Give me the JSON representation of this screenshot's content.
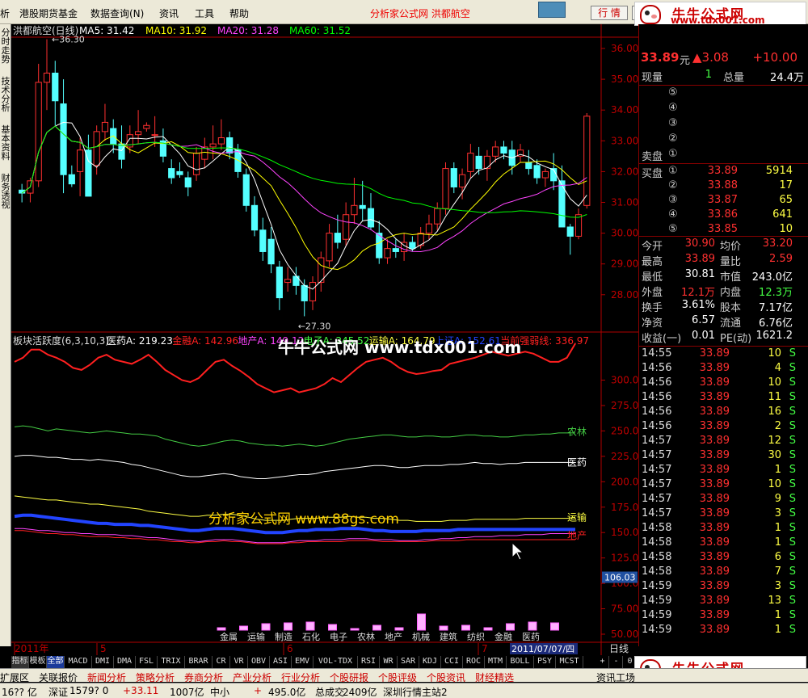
{
  "menu": {
    "items": [
      "析",
      "港股期货基金",
      "数据查询(N)",
      "资讯",
      "工具",
      "帮助"
    ],
    "site_title": "分析家公式网 洪都航空",
    "btn_quote": "行 情",
    "btn_info": "资 讯"
  },
  "logo": {
    "line1": "牛牛公式网",
    "line2": "www.tdx001.com"
  },
  "lefttabs": [
    "分时走势",
    "技术分析",
    "基本资料",
    "财务透视"
  ],
  "kline": {
    "title": "洪都航空(日线)",
    "mas": [
      {
        "label": "MA5: 31.42",
        "color": "#ffffff"
      },
      {
        "label": "MA10: 31.92",
        "color": "#ffff00"
      },
      {
        "label": "MA20: 31.28",
        "color": "#ff44ff"
      },
      {
        "label": "MA60: 31.52",
        "color": "#00ff00"
      }
    ],
    "yticks": [
      "36.00",
      "35.00",
      "34.00",
      "33.00",
      "32.00",
      "31.00",
      "30.00",
      "29.00",
      "28.00"
    ],
    "high_mark": "36.30",
    "low_mark": "27.30",
    "candles": [
      [
        31.4,
        31.6,
        31.0,
        31.3
      ],
      [
        31.3,
        31.8,
        31.0,
        31.7
      ],
      [
        31.7,
        35.5,
        31.5,
        34.9
      ],
      [
        34.9,
        36.3,
        34.0,
        35.2
      ],
      [
        35.2,
        35.6,
        33.5,
        34.3
      ],
      [
        34.2,
        35.0,
        31.3,
        31.9
      ],
      [
        31.9,
        32.2,
        31.5,
        31.6
      ],
      [
        32.0,
        33.1,
        31.2,
        32.7
      ],
      [
        32.7,
        33.2,
        31.3,
        31.2
      ],
      [
        32.2,
        33.5,
        31.9,
        33.3
      ],
      [
        33.3,
        34.2,
        33.0,
        33.6
      ],
      [
        33.4,
        33.7,
        32.6,
        32.9
      ],
      [
        32.9,
        33.5,
        32.1,
        32.4
      ],
      [
        32.8,
        33.5,
        32.6,
        33.2
      ],
      [
        33.2,
        34.0,
        32.9,
        33.3
      ],
      [
        33.4,
        33.6,
        33.3,
        33.5
      ],
      [
        33.2,
        33.8,
        32.8,
        33.2
      ],
      [
        33.0,
        33.4,
        32.3,
        32.5
      ],
      [
        32.1,
        32.4,
        31.6,
        31.8
      ],
      [
        32.0,
        32.3,
        31.8,
        31.9
      ],
      [
        31.8,
        32.0,
        31.2,
        31.5
      ],
      [
        31.9,
        32.8,
        31.7,
        32.6
      ],
      [
        32.4,
        33.1,
        32.1,
        32.8
      ],
      [
        32.8,
        33.5,
        32.4,
        32.9
      ],
      [
        32.9,
        33.7,
        32.7,
        33.1
      ],
      [
        33.1,
        33.3,
        32.4,
        32.6
      ],
      [
        32.7,
        32.9,
        31.8,
        32.0
      ],
      [
        31.9,
        32.1,
        30.7,
        30.9
      ],
      [
        30.9,
        31.2,
        29.9,
        30.1
      ],
      [
        30.1,
        30.5,
        29.1,
        29.4
      ],
      [
        29.8,
        30.2,
        28.7,
        29.0
      ],
      [
        28.9,
        29.1,
        27.5,
        27.9
      ],
      [
        28.4,
        28.9,
        28.1,
        28.5
      ],
      [
        28.6,
        28.9,
        28.0,
        28.3
      ],
      [
        28.3,
        28.5,
        27.3,
        27.8
      ],
      [
        27.8,
        28.6,
        27.5,
        28.4
      ],
      [
        28.4,
        29.4,
        28.1,
        29.2
      ],
      [
        29.1,
        30.3,
        28.9,
        30.0
      ],
      [
        30.0,
        30.6,
        29.5,
        29.7
      ],
      [
        29.8,
        31.0,
        29.6,
        30.6
      ],
      [
        30.6,
        31.8,
        30.3,
        30.9
      ],
      [
        30.9,
        31.7,
        30.4,
        30.8
      ],
      [
        30.8,
        31.3,
        30.1,
        30.2
      ],
      [
        30.0,
        30.4,
        29.0,
        29.2
      ],
      [
        29.2,
        29.8,
        29.0,
        29.5
      ],
      [
        29.5,
        29.8,
        29.2,
        29.4
      ],
      [
        29.4,
        30.0,
        29.1,
        29.7
      ],
      [
        29.7,
        29.9,
        29.4,
        29.5
      ],
      [
        29.6,
        30.2,
        29.5,
        30.0
      ],
      [
        30.0,
        30.6,
        29.8,
        30.3
      ],
      [
        30.3,
        31.0,
        30.1,
        30.8
      ],
      [
        30.8,
        32.3,
        30.6,
        32.1
      ],
      [
        32.1,
        32.3,
        31.3,
        31.5
      ],
      [
        31.5,
        32.1,
        31.1,
        31.9
      ],
      [
        32.0,
        32.9,
        31.8,
        32.6
      ],
      [
        32.5,
        32.8,
        31.9,
        32.1
      ],
      [
        32.1,
        32.7,
        31.7,
        32.5
      ],
      [
        32.5,
        33.0,
        32.3,
        32.8
      ],
      [
        32.8,
        33.0,
        32.4,
        32.6
      ],
      [
        32.7,
        33.0,
        31.9,
        32.2
      ],
      [
        32.5,
        32.9,
        32.3,
        32.7
      ],
      [
        32.3,
        32.7,
        31.9,
        32.1
      ],
      [
        32.2,
        32.4,
        31.6,
        31.8
      ],
      [
        31.8,
        32.1,
        31.5,
        32.0
      ],
      [
        32.1,
        32.6,
        31.4,
        31.7
      ],
      [
        31.7,
        32.2,
        30.6,
        30.2
      ],
      [
        30.2,
        30.3,
        29.3,
        29.9
      ],
      [
        29.9,
        30.8,
        29.8,
        30.6
      ],
      [
        30.9,
        33.9,
        30.8,
        33.8
      ]
    ]
  },
  "indicator": {
    "title": "板块活跃度(6,3,10,3)",
    "legend": [
      {
        "text": "医药A: 219.23",
        "color": "#ffffff"
      },
      {
        "text": "金融A: 142.96",
        "color": "#ff2020"
      },
      {
        "text": "地产A: 149.12",
        "color": "#ff44ff"
      },
      {
        "text": "电子A: 245.52",
        "color": "#44ff44"
      },
      {
        "text": "运输A: 164.79",
        "color": "#ffff44"
      },
      {
        "text": "上证A: 152.61",
        "color": "#2244ff"
      },
      {
        "text": "当前强弱线: 336.97",
        "color": "#ff2020"
      }
    ],
    "yticks": [
      "300.00",
      "275.00",
      "250.00",
      "225.00",
      "200.00",
      "175.00",
      "150.00",
      "125.00",
      "100.00",
      "75.00",
      "50.00",
      "25.00"
    ],
    "current_value": "106.03",
    "line_labels": [
      "农林",
      "医药",
      "运输",
      "地产"
    ],
    "bar_labels": [
      "金属",
      "运输",
      "制造",
      "石化",
      "电子",
      "农林",
      "地产",
      "机械",
      "建筑",
      "纺织",
      "金融",
      "医药"
    ],
    "bar_values": [
      3,
      5,
      8,
      9,
      10,
      7,
      2,
      6,
      3,
      20,
      5,
      6,
      3,
      8,
      10,
      9
    ],
    "series": {
      "top": [
        318,
        322,
        330,
        330,
        325,
        322,
        318,
        312,
        310,
        315,
        322,
        325,
        320,
        318,
        316,
        320,
        325,
        318,
        310,
        305,
        300,
        298,
        302,
        310,
        318,
        320,
        314,
        309,
        303,
        296,
        292,
        288,
        290,
        292,
        288,
        290,
        292,
        296,
        302,
        298,
        305,
        312,
        318,
        320,
        322,
        318,
        312,
        308,
        306,
        307,
        309,
        310,
        316,
        318,
        320,
        322,
        325,
        328,
        326,
        324,
        326,
        328,
        326,
        322,
        318,
        318,
        322,
        336
      ],
      "nonglin": [
        254,
        255,
        254,
        252,
        250,
        252,
        251,
        250,
        249,
        248,
        249,
        250,
        249,
        248,
        247,
        247,
        246,
        245,
        242,
        240,
        238,
        236,
        235,
        236,
        238,
        240,
        241,
        240,
        238,
        237,
        236,
        236,
        235,
        236,
        237,
        236,
        235,
        236,
        238,
        240,
        242,
        243,
        244,
        245,
        246,
        246,
        245,
        244,
        244,
        245,
        245,
        244,
        244,
        245,
        246,
        246,
        245,
        245,
        244,
        244,
        245,
        246,
        246,
        247,
        247,
        248,
        248,
        248
      ],
      "yiyao": [
        225,
        226,
        226,
        225,
        224,
        224,
        223,
        222,
        222,
        221,
        222,
        221,
        220,
        219,
        217,
        216,
        214,
        212,
        210,
        208,
        206,
        205,
        205,
        206,
        207,
        208,
        207,
        205,
        204,
        203,
        203,
        204,
        205,
        206,
        207,
        207,
        208,
        210,
        211,
        212,
        213,
        214,
        215,
        216,
        216,
        215,
        214,
        214,
        215,
        216,
        216,
        216,
        217,
        217,
        218,
        219,
        218,
        218,
        217,
        218,
        218,
        219,
        219,
        219,
        219,
        219,
        219,
        219
      ],
      "yunshu": [
        186,
        185,
        184,
        183,
        182,
        182,
        181,
        180,
        179,
        178,
        178,
        177,
        176,
        175,
        174,
        173,
        171,
        170,
        169,
        168,
        167,
        166,
        166,
        167,
        167,
        168,
        168,
        167,
        165,
        163,
        162,
        162,
        162,
        163,
        164,
        164,
        164,
        165,
        165,
        165,
        166,
        165,
        165,
        164,
        164,
        163,
        162,
        162,
        161,
        161,
        161,
        161,
        162,
        162,
        162,
        163,
        163,
        163,
        163,
        163,
        163,
        164,
        164,
        164,
        164,
        164,
        164,
        165
      ],
      "shangzheng": [
        166,
        167,
        167,
        166,
        165,
        164,
        163,
        162,
        161,
        160,
        159,
        159,
        158,
        158,
        158,
        157,
        157,
        156,
        155,
        154,
        153,
        152,
        152,
        153,
        154,
        154,
        154,
        153,
        152,
        151,
        150,
        150,
        150,
        151,
        152,
        152,
        153,
        153,
        153,
        154,
        154,
        154,
        153,
        152,
        152,
        151,
        151,
        151,
        151,
        152,
        152,
        152,
        152,
        153,
        153,
        153,
        153,
        153,
        153,
        153,
        153,
        153,
        153,
        153,
        153,
        153,
        153,
        153
      ],
      "dichan": [
        154,
        154,
        153,
        152,
        152,
        151,
        150,
        150,
        149,
        149,
        148,
        148,
        148,
        147,
        147,
        146,
        145,
        145,
        144,
        143,
        142,
        142,
        141,
        142,
        143,
        143,
        143,
        142,
        141,
        140,
        140,
        140,
        140,
        141,
        142,
        142,
        142,
        143,
        143,
        143,
        144,
        144,
        144,
        143,
        143,
        143,
        142,
        142,
        142,
        143,
        143,
        144,
        144,
        145,
        145,
        146,
        146,
        146,
        147,
        147,
        147,
        148,
        148,
        148,
        149,
        149,
        149,
        149
      ],
      "jinrong": [
        152,
        152,
        151,
        150,
        149,
        149,
        148,
        148,
        147,
        146,
        146,
        146,
        145,
        145,
        144,
        144,
        143,
        143,
        142,
        141,
        141,
        140,
        140,
        141,
        141,
        142,
        141,
        141,
        140,
        139,
        139,
        139,
        139,
        140,
        140,
        141,
        141,
        141,
        141,
        141,
        142,
        142,
        142,
        142,
        141,
        141,
        141,
        141,
        141,
        141,
        142,
        142,
        142,
        142,
        143,
        143,
        143,
        143,
        143,
        143,
        143,
        143,
        143,
        143,
        143,
        143,
        143,
        143
      ]
    }
  },
  "watermarks": {
    "w1": "牛牛公式网 www.tdx001.com",
    "w2": "分析家公式网 www.88gs.com"
  },
  "timeline": {
    "labels": [
      "2011年",
      "5",
      "6",
      "7"
    ],
    "date_box": "2011/07/07/四",
    "period": "日线"
  },
  "indicator_tabs": [
    "指标",
    "模板",
    "全部",
    "MACD",
    "DMI",
    "DMA",
    "FSL",
    "TRIX",
    "BRAR",
    "CR",
    "VR",
    "OBV",
    "ASI",
    "EMV",
    "VOL-TDX",
    "RSI",
    "WR",
    "SAR",
    "KDJ",
    "CCI",
    "ROC",
    "MTM",
    "BOLL",
    "PSY",
    "MCST"
  ],
  "scroll_controls": [
    "+",
    "-",
    "0"
  ],
  "nav": [
    "扩展区",
    "关联报价",
    "新闻分析",
    "策略分析",
    "券商分析",
    "产业分析",
    "行业分析",
    "个股研报",
    "个股评级",
    "个股资讯",
    "财经精选"
  ],
  "nav_right": "资讯工场",
  "status": [
    "16?? 亿",
    "深证",
    "1579? 0",
    "+33.11",
    "1007亿",
    "中小",
    "",
    "",
    "+",
    "495.0亿",
    "总成交",
    "2409亿",
    "深圳行情主站2"
  ],
  "quote": {
    "price": "33.89",
    "unit": "元",
    "change": "▲3.08",
    "pct": "+10.00",
    "xianliang_label": "现量",
    "xianliang": "1",
    "zongliang_label": "总量",
    "zongliang": "24.4万",
    "sell_levels": [
      "⑤",
      "④",
      "③",
      "②",
      "①"
    ],
    "sell_label": "卖盘",
    "buy_label": "买盘",
    "buy": [
      {
        "lvl": "①",
        "price": "33.89",
        "vol": "5914"
      },
      {
        "lvl": "②",
        "price": "33.88",
        "vol": "17"
      },
      {
        "lvl": "③",
        "price": "33.87",
        "vol": "65"
      },
      {
        "lvl": "④",
        "price": "33.86",
        "vol": "641"
      },
      {
        "lvl": "⑤",
        "price": "33.85",
        "vol": "10"
      }
    ],
    "stats": [
      {
        "l1": "今开",
        "v1": "30.90",
        "c1": "#ff3030",
        "l2": "均价",
        "v2": "33.20",
        "c2": "#ff3030"
      },
      {
        "l1": "最高",
        "v1": "33.89",
        "c1": "#ff3030",
        "l2": "量比",
        "v2": "2.59",
        "c2": "#ff3030"
      },
      {
        "l1": "最低",
        "v1": "30.81",
        "c1": "#ffffff",
        "l2": "市值",
        "v2": "243.0亿",
        "c2": "#ffffff"
      },
      {
        "l1": "外盘",
        "v1": "12.1万",
        "c1": "#ff3030",
        "l2": "内盘",
        "v2": "12.3万",
        "c2": "#44ff44"
      },
      {
        "l1": "换手",
        "v1": "3.61%",
        "c1": "#ffffff",
        "l2": "股本",
        "v2": "7.17亿",
        "c2": "#ffffff"
      },
      {
        "l1": "净资",
        "v1": "6.57",
        "c1": "#ffffff",
        "l2": "流通",
        "v2": "6.76亿",
        "c2": "#ffffff"
      },
      {
        "l1": "收益(一)",
        "v1": "0.01",
        "c1": "#ffffff",
        "l2": "PE(动)",
        "v2": "1621.2",
        "c2": "#ffffff"
      }
    ],
    "ticks": [
      {
        "t": "14:55",
        "p": "33.89",
        "v": "10",
        "s": "S"
      },
      {
        "t": "14:56",
        "p": "33.89",
        "v": "4",
        "s": "S"
      },
      {
        "t": "14:56",
        "p": "33.89",
        "v": "10",
        "s": "S"
      },
      {
        "t": "14:56",
        "p": "33.89",
        "v": "11",
        "s": "S"
      },
      {
        "t": "14:56",
        "p": "33.89",
        "v": "16",
        "s": "S"
      },
      {
        "t": "14:56",
        "p": "33.89",
        "v": "2",
        "s": "S"
      },
      {
        "t": "14:57",
        "p": "33.89",
        "v": "12",
        "s": "S"
      },
      {
        "t": "14:57",
        "p": "33.89",
        "v": "30",
        "s": "S"
      },
      {
        "t": "14:57",
        "p": "33.89",
        "v": "1",
        "s": "S"
      },
      {
        "t": "14:57",
        "p": "33.89",
        "v": "10",
        "s": "S"
      },
      {
        "t": "14:57",
        "p": "33.89",
        "v": "9",
        "s": "S"
      },
      {
        "t": "14:57",
        "p": "33.89",
        "v": "3",
        "s": "S"
      },
      {
        "t": "14:58",
        "p": "33.89",
        "v": "1",
        "s": "S"
      },
      {
        "t": "14:58",
        "p": "33.89",
        "v": "1",
        "s": "S"
      },
      {
        "t": "14:58",
        "p": "33.89",
        "v": "6",
        "s": "S"
      },
      {
        "t": "14:58",
        "p": "33.89",
        "v": "7",
        "s": "S"
      },
      {
        "t": "14:59",
        "p": "33.89",
        "v": "3",
        "s": "S"
      },
      {
        "t": "14:59",
        "p": "33.89",
        "v": "13",
        "s": "S"
      },
      {
        "t": "14:59",
        "p": "33.89",
        "v": "1",
        "s": "S"
      },
      {
        "t": "14:59",
        "p": "33.89",
        "v": "1",
        "s": "S"
      }
    ]
  }
}
